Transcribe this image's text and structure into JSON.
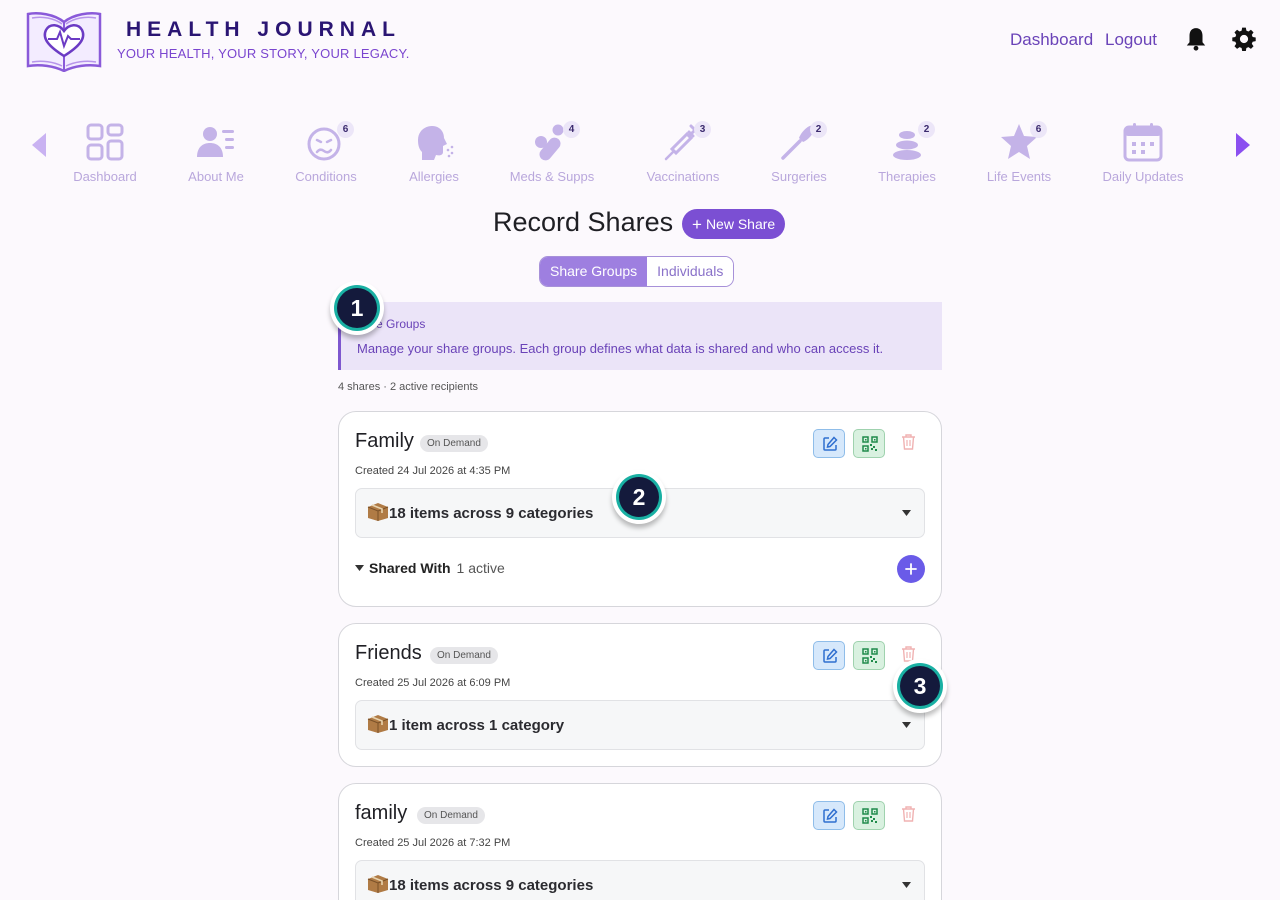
{
  "header": {
    "brand_title": "HEALTH JOURNAL",
    "tagline": "YOUR HEALTH, YOUR STORY, YOUR LEGACY.",
    "links": [
      "Dashboard",
      "Logout"
    ],
    "icons": [
      "bell-icon",
      "gear-icon"
    ]
  },
  "nav": {
    "items": [
      {
        "label": "Dashboard",
        "icon": "dashboard-grid-icon",
        "badge": ""
      },
      {
        "label": "About Me",
        "icon": "user-profile-icon",
        "badge": ""
      },
      {
        "label": "Conditions",
        "icon": "sick-face-icon",
        "badge": "6"
      },
      {
        "label": "Allergies",
        "icon": "sneeze-head-icon",
        "badge": ""
      },
      {
        "label": "Meds & Supps",
        "icon": "pills-icon",
        "badge": "4"
      },
      {
        "label": "Vaccinations",
        "icon": "syringe-icon",
        "badge": "3"
      },
      {
        "label": "Surgeries",
        "icon": "scalpel-icon",
        "badge": "2"
      },
      {
        "label": "Therapies",
        "icon": "spa-stones-icon",
        "badge": "2"
      },
      {
        "label": "Life Events",
        "icon": "star-icon",
        "badge": "6"
      },
      {
        "label": "Daily Updates",
        "icon": "calendar-icon",
        "badge": ""
      }
    ],
    "colors": {
      "active_arrow": "#8b4ff0",
      "inactive_arrow": "#c9b2f2",
      "icon": "#c4b3e8"
    }
  },
  "page": {
    "title": "Record Shares",
    "new_share_label": "New Share",
    "tabs": [
      "Share Groups",
      "Individuals"
    ],
    "active_tab": "Share Groups"
  },
  "info": {
    "title": "e Groups",
    "description": "Manage your share groups. Each group defines what data is shared and who can access it."
  },
  "summary": "4 shares · 2 active recipients",
  "cards": [
    {
      "name": "Family",
      "mode": "On Demand",
      "created": "Created 24 Jul 2026 at 4:35 PM",
      "items": "18 items across 9 categories",
      "shared_with_label": "Shared With",
      "shared_with_count": "1 active"
    },
    {
      "name": "Friends",
      "mode": "On Demand",
      "created": "Created 25 Jul 2026 at 6:09 PM",
      "items": "1 item across 1 category"
    },
    {
      "name": "family",
      "mode": "On Demand",
      "created": "Created 25 Jul 2026 at 7:32 PM",
      "items": "18 items across 9 categories"
    }
  ],
  "markers": [
    "1",
    "2",
    "3"
  ],
  "colors": {
    "primary": "#7b4fd3",
    "marker_ring": "#19b0a3",
    "marker_fill": "#141a3c"
  }
}
